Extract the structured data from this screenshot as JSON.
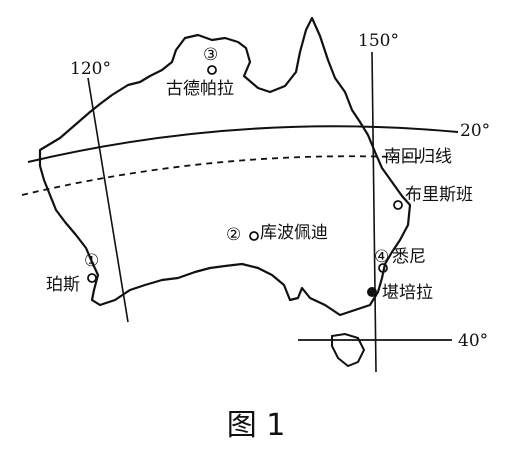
{
  "map": {
    "caption": "图 1",
    "meridians": {
      "lon_120": "120°",
      "lon_150": "150°"
    },
    "parallels": {
      "lat_20": "20°",
      "lat_40": "40°"
    },
    "tropic_label": "南回归线",
    "cities": [
      {
        "marker": "①",
        "name": "珀斯"
      },
      {
        "marker": "②",
        "name": "库波佩迪"
      },
      {
        "marker": "③",
        "name": "古德帕拉"
      },
      {
        "marker": "④",
        "name": "悉尼"
      }
    ],
    "other_cities": {
      "brisbane": "布里斯班",
      "canberra": "堪培拉"
    }
  }
}
